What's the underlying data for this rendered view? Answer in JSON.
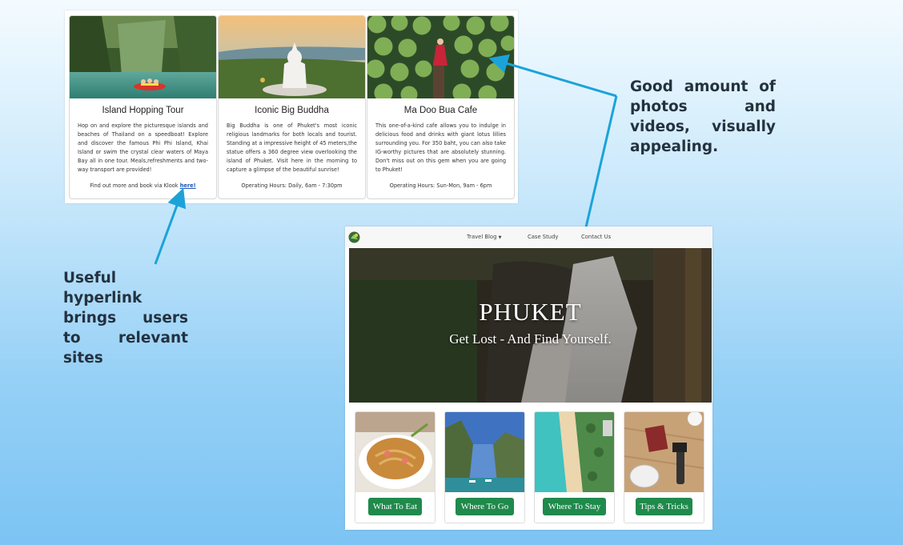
{
  "cards": [
    {
      "title": "Island Hopping Tour",
      "body": "Hop on and explore the picturesque islands and beaches of Thailand on a speedboat! Explore and discover the famous Phi Phi Island, Khai Island or swim the crystal clear waters of Maya Bay all in one tour. Meals,refreshments and two-way transport are provided!",
      "footer_prefix": "Find out more and book via Klook ",
      "footer_link": "here!"
    },
    {
      "title": "Iconic Big Buddha",
      "body": "Big Buddha is one of Phuket's most iconic religious landmarks for both locals and tourist. Standing at a impressive height of 45 meters,the statue offers a 360 degree view overlooking the island of Phuket. Visit here in the morning to capture a glimpse of the beautiful sunrise!",
      "footer": "Operating Hours: Daily, 6am - 7:30pm"
    },
    {
      "title": "Ma Doo Bua Cafe",
      "body": "This one-of-a-kind cafe allows you to indulge in delicious food and drinks with giant lotus lillies surrounding you. For 350 baht, you can also take IG-worthy pictures that are absolutely stunning. Don't miss out on this gem when you are going to Phuket!",
      "footer": "Operating Hours: Sun-Mon, 9am - 6pm"
    }
  ],
  "annotations": {
    "right": "Good amount of photos and videos, visually appealing.",
    "left": "Useful hyperlink brings users to relevant sites"
  },
  "site": {
    "nav": {
      "travel_blog": "Travel Blog",
      "case_study": "Case Study",
      "contact_us": "Contact Us"
    },
    "hero": {
      "title": "PHUKET",
      "subtitle": "Get Lost - And Find Yourself."
    },
    "tiles": [
      {
        "label": "What To Eat"
      },
      {
        "label": "Where To Go"
      },
      {
        "label": "Where To Stay"
      },
      {
        "label": "Tips & Tricks"
      }
    ]
  },
  "colors": {
    "button_green": "#1f8a4c",
    "arrow_blue": "#1ba3d9",
    "annotation_text": "#243240"
  }
}
